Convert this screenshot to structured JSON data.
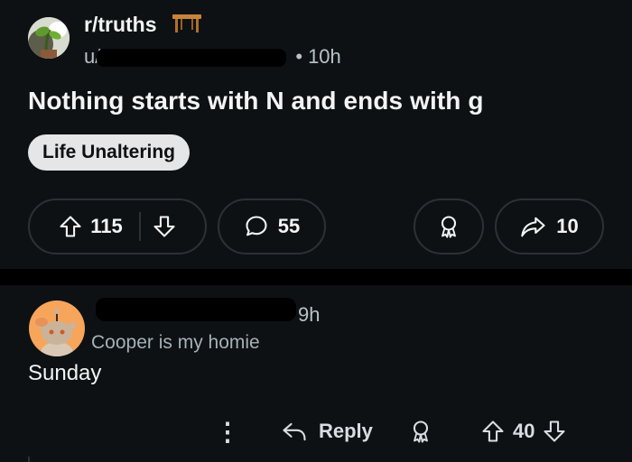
{
  "post": {
    "subreddit": "r/truths",
    "user_prefix": "u/",
    "time_dot": "•",
    "time": "10h",
    "title": "Nothing starts with N and ends with g",
    "flair": "Life Unaltering",
    "upvotes": "115",
    "comments": "55",
    "shares": "10"
  },
  "comment": {
    "time": "9h",
    "flair": "Cooper is my homie",
    "body": "Sunday",
    "more": "⋮",
    "reply_label": "Reply",
    "votes": "40"
  },
  "colors": {
    "background": "#0e1113",
    "flair_bg": "#e4e6e8",
    "avatar_orange": "#f7a55b",
    "border": "#2a3236"
  }
}
